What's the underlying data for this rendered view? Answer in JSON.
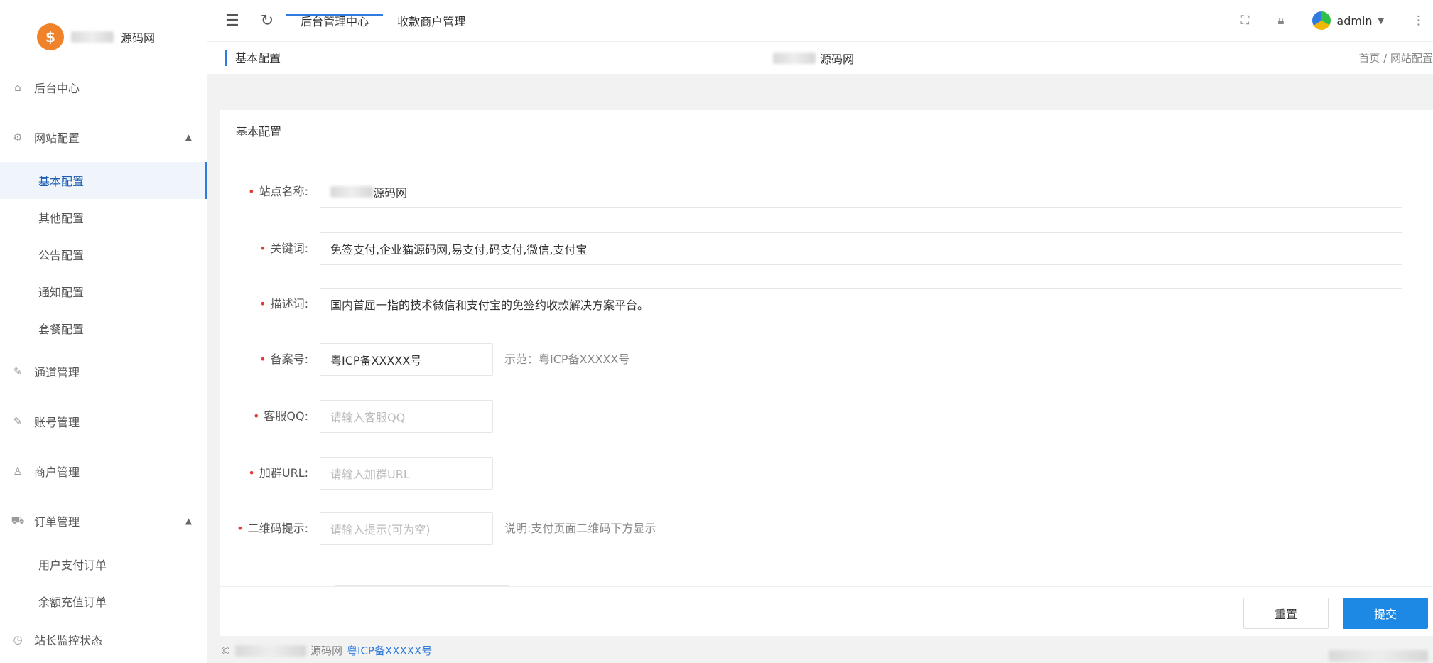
{
  "brand": {
    "name_suffix": "源码网"
  },
  "sidebar": {
    "items": [
      {
        "label": "后台中心"
      },
      {
        "label": "网站配置"
      },
      {
        "label": "通道管理"
      },
      {
        "label": "账号管理"
      },
      {
        "label": "商户管理"
      },
      {
        "label": "订单管理"
      },
      {
        "label": "站长监控状态"
      }
    ],
    "website_sub": [
      "基本配置",
      "其他配置",
      "公告配置",
      "通知配置",
      "套餐配置"
    ],
    "order_sub": [
      "用户支付订单",
      "余额充值订单"
    ]
  },
  "header": {
    "tabs": [
      "后台管理中心",
      "收款商户管理"
    ],
    "user": "admin",
    "page_title": "基本配置",
    "center_title_suffix": "源码网",
    "breadcrumb": "首页 / 网站配置"
  },
  "panel": {
    "title": "基本配置",
    "fields": [
      {
        "label": "站点名称:",
        "value_suffix": "源码网"
      },
      {
        "label": "关键词:",
        "value": "免签支付,企业猫源码网,易支付,码支付,微信,支付宝"
      },
      {
        "label": "描述词:",
        "value": "国内首屈一指的技术微信和支付宝的免签约收款解决方案平台。"
      },
      {
        "label": "备案号:",
        "value": "粤ICP备XXXXX号",
        "hint": "示范：粤ICP备XXXXX号"
      },
      {
        "label": "客服QQ:",
        "placeholder": "请输入客服QQ"
      },
      {
        "label": "加群URL:",
        "placeholder": "请输入加群URL"
      },
      {
        "label": "二维码提示:",
        "placeholder": "请输入提示(可为空)",
        "hint": "说明:支付页面二维码下方显示"
      }
    ]
  },
  "actions": {
    "reset": "重置",
    "submit": "提交"
  },
  "footer": {
    "site_suffix": "源码网",
    "icp": "粤ICP备XXXXX号"
  }
}
